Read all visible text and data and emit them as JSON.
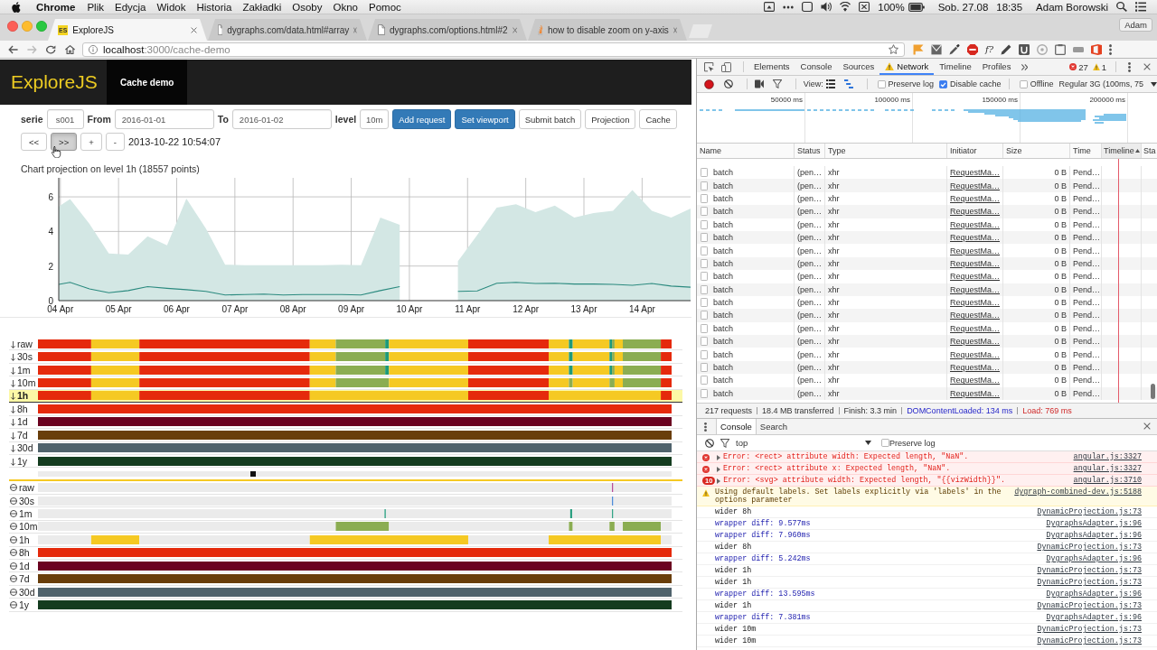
{
  "menu_bar": {
    "app_name": "Chrome",
    "menus": [
      "Plik",
      "Edycja",
      "Widok",
      "Historia",
      "Zakładki",
      "Osoby",
      "Okno",
      "Pomoc"
    ],
    "battery": "100%",
    "date": "Sob. 27.08",
    "time": "18:35",
    "user": "Adam Borowski"
  },
  "browser": {
    "tabs": [
      {
        "kind": "badge",
        "favicon": "ES",
        "title": "ExploreJS",
        "selected": true
      },
      {
        "kind": "page",
        "title": "dygraphs.com/data.html#array",
        "selected": false
      },
      {
        "kind": "page",
        "title": "dygraphs.com/options.html#2",
        "selected": false
      },
      {
        "kind": "site",
        "title": "how to disable zoom on y-axis",
        "selected": false
      }
    ],
    "profile": "Adam",
    "url_host": "localhost",
    "url_path": ":3000/cache-demo",
    "extension_text": "f?"
  },
  "app": {
    "brand": "ExploreJS",
    "nav": [
      {
        "label": "Cache demo",
        "selected": true
      }
    ],
    "fields": [
      {
        "label": "serie",
        "value": "s001",
        "kind": "short"
      },
      {
        "label": "From",
        "value": "2016-01-01",
        "kind": "date"
      },
      {
        "label": "To",
        "value": "2016-01-02",
        "kind": "date"
      },
      {
        "label": "level",
        "value": "10m",
        "kind": "tiny"
      }
    ],
    "buttons": [
      {
        "label": "Add request",
        "kind": "primary"
      },
      {
        "label": "Set viewport",
        "kind": "primary"
      },
      {
        "label": "Submit batch",
        "kind": "default"
      },
      {
        "label": "Projection",
        "kind": "default"
      },
      {
        "label": "Cache",
        "kind": "default"
      }
    ],
    "step_buttons": [
      {
        "label": "<<",
        "pressed": false
      },
      {
        "label": ">>",
        "pressed": true
      },
      {
        "label": "+",
        "pressed": false
      },
      {
        "label": "-",
        "pressed": false
      }
    ],
    "timestamp": "2013-10-22 10:54:07",
    "chart_data": [
      {
        "type": "area",
        "title": "Chart projection on level 1h (18557 points)",
        "series": [
          {
            "type": "area",
            "color": "#d3e7e4",
            "x": [
              "--04-03T23:20",
              "--04-04T04:00",
              "--04-04T12:00",
              "--04-04T20:00",
              "--04-05T04:00",
              "--04-05T12:00",
              "--04-05T20:00",
              "--04-06T04:00",
              "--04-06T12:00",
              "--04-06T20:00",
              "--04-07T04:00",
              "--04-07T12:00",
              "--04-07T20:00",
              "--04-08T04:00",
              "--04-08T12:00",
              "--04-08T20:00",
              "--04-09T04:00",
              "--04-09T12:00",
              "--04-09T20:00"
            ],
            "values": [
              5.44,
              5.87,
              4.43,
              2.73,
              2.66,
              3.72,
              3.2,
              5.9,
              4.18,
              2.08,
              2.05,
              2.05,
              2.05,
              2.05,
              2.05,
              2.07,
              2.05,
              4.8,
              4.38
            ]
          },
          {
            "type": "area",
            "color": "#d3e7e4",
            "x": [
              "--04-10T20:00",
              "--04-11T04:00",
              "--04-11T12:00",
              "--04-11T20:00",
              "--04-12T04:00",
              "--04-12T12:00",
              "--04-12T20:00",
              "--04-13T04:00",
              "--04-13T12:00",
              "--04-13T20:00",
              "--04-14T04:00",
              "--04-14T12:00",
              "--04-14T20:00"
            ],
            "values": [
              2.28,
              3.8,
              5.37,
              5.57,
              5.11,
              5.49,
              4.81,
              5.06,
              5.19,
              6.4,
              5.19,
              4.81,
              5.32
            ]
          },
          {
            "type": "line",
            "color": "#2b8a7f",
            "x": [
              "--04-03T23:20",
              "--04-04T04:00",
              "--04-04T12:00",
              "--04-04T20:00",
              "--04-05T04:00",
              "--04-05T12:00",
              "--04-05T20:00",
              "--04-06T04:00",
              "--04-06T12:00",
              "--04-06T20:00",
              "--04-07T04:00",
              "--04-07T12:00",
              "--04-07T20:00",
              "--04-08T04:00",
              "--04-08T12:00",
              "--04-08T20:00",
              "--04-09T04:00",
              "--04-09T12:00",
              "--04-09T20:00"
            ],
            "values": [
              0.94,
              1.06,
              0.68,
              0.46,
              0.58,
              0.81,
              0.71,
              0.63,
              0.53,
              0.33,
              0.35,
              0.38,
              0.33,
              0.35,
              0.35,
              0.35,
              0.33,
              0.58,
              0.81
            ]
          },
          {
            "type": "line",
            "color": "#2b8a7f",
            "x": [
              "--04-10T20:00",
              "--04-11T04:00",
              "--04-11T12:00",
              "--04-11T20:00",
              "--04-12T04:00",
              "--04-12T12:00",
              "--04-12T20:00",
              "--04-13T04:00",
              "--04-13T12:00",
              "--04-13T20:00",
              "--04-14T04:00",
              "--04-14T12:00",
              "--04-14T20:00"
            ],
            "values": [
              0.53,
              0.56,
              1.01,
              1.06,
              0.99,
              1.01,
              0.96,
              0.96,
              0.94,
              0.89,
              0.99,
              0.84,
              0.78
            ]
          }
        ],
        "xlim": [
          "--04-03T23:20",
          "--04-14T20:00"
        ],
        "ylim": [
          0,
          7.1
        ],
        "yticks": [
          0,
          2,
          4,
          6
        ],
        "xticks": [
          {
            "value": "--04-04",
            "label": "04 Apr"
          },
          {
            "value": "--04-05",
            "label": "05 Apr"
          },
          {
            "value": "--04-06",
            "label": "06 Apr"
          },
          {
            "value": "--04-07",
            "label": "07 Apr"
          },
          {
            "value": "--04-08",
            "label": "08 Apr"
          },
          {
            "value": "--04-09",
            "label": "09 Apr"
          },
          {
            "value": "--04-10",
            "label": "10 Apr"
          },
          {
            "value": "--04-11",
            "label": "11 Apr"
          },
          {
            "value": "--04-12",
            "label": "12 Apr"
          },
          {
            "value": "--04-13",
            "label": "13 Apr"
          },
          {
            "value": "--04-14",
            "label": "14 Apr"
          }
        ],
        "grid": true
      }
    ],
    "cache_levels": [
      {
        "label": "raw",
        "selected": false
      },
      {
        "label": "30s",
        "selected": false
      },
      {
        "label": "1m",
        "selected": false
      },
      {
        "label": "10m",
        "selected": false
      },
      {
        "label": "1h",
        "selected": true
      },
      {
        "label": "8h",
        "selected": false
      },
      {
        "label": "1d",
        "selected": false
      },
      {
        "label": "7d",
        "selected": false
      },
      {
        "label": "30d",
        "selected": false
      },
      {
        "label": "1y",
        "selected": false
      }
    ],
    "scrubber": {
      "level": 0.34
    },
    "projection_levels": [
      {
        "label": "raw",
        "selected": false
      },
      {
        "label": "30s",
        "selected": false
      },
      {
        "label": "1m",
        "selected": false
      },
      {
        "label": "10m",
        "selected": false
      },
      {
        "label": "1h",
        "selected": false
      },
      {
        "label": "8h",
        "selected": false
      },
      {
        "label": "1d",
        "selected": false
      },
      {
        "label": "7d",
        "selected": false
      },
      {
        "label": "30d",
        "selected": false
      },
      {
        "label": "1y",
        "selected": false
      }
    ]
  },
  "devtools": {
    "panels": [
      {
        "label": "Elements",
        "selected": false,
        "warning": false
      },
      {
        "label": "Console",
        "selected": false,
        "warning": false
      },
      {
        "label": "Sources",
        "selected": false,
        "warning": false
      },
      {
        "label": "Network",
        "selected": true,
        "warning": true
      },
      {
        "label": "Timeline",
        "selected": false,
        "warning": false
      },
      {
        "label": "Profiles",
        "selected": false,
        "warning": false
      }
    ],
    "error_count": "27",
    "warning_count": "1",
    "network": {
      "recording": true,
      "view_label": "View:",
      "options": [
        {
          "label": "Preserve log",
          "checked": false
        },
        {
          "label": "Disable cache",
          "checked": true
        },
        {
          "label": "Offline",
          "checked": false
        }
      ],
      "throttling": "Regular 3G (100ms, 75",
      "overview_ticks": [
        "50000 ms",
        "100000 ms",
        "150000 ms",
        "200000 ms"
      ],
      "columns": [
        {
          "label": "Name",
          "sorted": false
        },
        {
          "label": "Status",
          "sorted": false
        },
        {
          "label": "Type",
          "sorted": false
        },
        {
          "label": "Initiator",
          "sorted": false
        },
        {
          "label": "Size",
          "sorted": false
        },
        {
          "label": "Time",
          "sorted": false
        },
        {
          "label": "Timeline",
          "sorted": true
        },
        {
          "label": "Sta",
          "sorted": false
        }
      ],
      "rows": [
        {
          "name": "batch",
          "status": "(pen…",
          "type": "xhr",
          "initiator": "RequestMa…",
          "size": "0 B",
          "time": "Pend…"
        },
        {
          "name": "batch",
          "status": "(pen…",
          "type": "xhr",
          "initiator": "RequestMa…",
          "size": "0 B",
          "time": "Pend…"
        },
        {
          "name": "batch",
          "status": "(pen…",
          "type": "xhr",
          "initiator": "RequestMa…",
          "size": "0 B",
          "time": "Pend…"
        },
        {
          "name": "batch",
          "status": "(pen…",
          "type": "xhr",
          "initiator": "RequestMa…",
          "size": "0 B",
          "time": "Pend…"
        },
        {
          "name": "batch",
          "status": "(pen…",
          "type": "xhr",
          "initiator": "RequestMa…",
          "size": "0 B",
          "time": "Pend…"
        },
        {
          "name": "batch",
          "status": "(pen…",
          "type": "xhr",
          "initiator": "RequestMa…",
          "size": "0 B",
          "time": "Pend…"
        },
        {
          "name": "batch",
          "status": "(pen…",
          "type": "xhr",
          "initiator": "RequestMa…",
          "size": "0 B",
          "time": "Pend…"
        },
        {
          "name": "batch",
          "status": "(pen…",
          "type": "xhr",
          "initiator": "RequestMa…",
          "size": "0 B",
          "time": "Pend…"
        },
        {
          "name": "batch",
          "status": "(pen…",
          "type": "xhr",
          "initiator": "RequestMa…",
          "size": "0 B",
          "time": "Pend…"
        },
        {
          "name": "batch",
          "status": "(pen…",
          "type": "xhr",
          "initiator": "RequestMa…",
          "size": "0 B",
          "time": "Pend…"
        },
        {
          "name": "batch",
          "status": "(pen…",
          "type": "xhr",
          "initiator": "RequestMa…",
          "size": "0 B",
          "time": "Pend…"
        },
        {
          "name": "batch",
          "status": "(pen…",
          "type": "xhr",
          "initiator": "RequestMa…",
          "size": "0 B",
          "time": "Pend…"
        },
        {
          "name": "batch",
          "status": "(pen…",
          "type": "xhr",
          "initiator": "RequestMa…",
          "size": "0 B",
          "time": "Pend…"
        },
        {
          "name": "batch",
          "status": "(pen…",
          "type": "xhr",
          "initiator": "RequestMa…",
          "size": "0 B",
          "time": "Pend…"
        },
        {
          "name": "batch",
          "status": "(pen…",
          "type": "xhr",
          "initiator": "RequestMa…",
          "size": "0 B",
          "time": "Pend…"
        },
        {
          "name": "batch",
          "status": "(pen…",
          "type": "xhr",
          "initiator": "RequestMa…",
          "size": "0 B",
          "time": "Pend…"
        },
        {
          "name": "batch",
          "status": "(pen…",
          "type": "xhr",
          "initiator": "RequestMa…",
          "size": "0 B",
          "time": "Pend…"
        },
        {
          "name": "batch",
          "status": "(pen…",
          "type": "xhr",
          "initiator": "RequestMa…",
          "size": "0 B",
          "time": "Pend…"
        }
      ],
      "summary": [
        {
          "text": "217 requests",
          "kind": "plain"
        },
        {
          "text": "18.4 MB transferred",
          "kind": "plain"
        },
        {
          "text": "Finish: 3.3 min",
          "kind": "plain"
        },
        {
          "text": "DOMContentLoaded: 134 ms",
          "kind": "dom"
        },
        {
          "text": "Load: 769 ms",
          "kind": "load"
        }
      ]
    },
    "console": {
      "tabs": [
        {
          "label": "Console",
          "selected": true
        },
        {
          "label": "Search",
          "selected": false
        }
      ],
      "context": "top",
      "preserve_log": {
        "label": "Preserve log",
        "checked": false
      },
      "messages": [
        {
          "kind": "error",
          "text": "Error: <rect> attribute width: Expected length, \"NaN\".",
          "source": "angular.js:3327"
        },
        {
          "kind": "error",
          "text": "Error: <rect> attribute x: Expected length, \"NaN\".",
          "source": "angular.js:3327"
        },
        {
          "kind": "error",
          "count": "10",
          "text": "Error: <svg> attribute width: Expected length, \"{{vizWidth}}\".",
          "source": "angular.js:3710"
        },
        {
          "kind": "warning",
          "text": "Using default labels. Set labels explicitly via 'labels' in the options parameter",
          "source": "dygraph-combined-dev.js:5188"
        },
        {
          "kind": "log",
          "text": "wider 8h",
          "source": "DynamicProjection.js:73"
        },
        {
          "kind": "debug",
          "text": "wrapper diff: 9.577ms",
          "source": "DygraphsAdapter.js:96"
        },
        {
          "kind": "debug",
          "text": "wrapper diff: 7.960ms",
          "source": "DygraphsAdapter.js:96"
        },
        {
          "kind": "log",
          "text": "wider 8h",
          "source": "DynamicProjection.js:73"
        },
        {
          "kind": "debug",
          "text": "wrapper diff: 5.242ms",
          "source": "DygraphsAdapter.js:96"
        },
        {
          "kind": "log",
          "text": "wider 1h",
          "source": "DynamicProjection.js:73"
        },
        {
          "kind": "log",
          "text": "wider 1h",
          "source": "DynamicProjection.js:73"
        },
        {
          "kind": "debug",
          "text": "wrapper diff: 13.595ms",
          "source": "DygraphsAdapter.js:96"
        },
        {
          "kind": "log",
          "text": "wider 1h",
          "source": "DynamicProjection.js:73"
        },
        {
          "kind": "debug",
          "text": "wrapper diff: 7.381ms",
          "source": "DygraphsAdapter.js:96"
        },
        {
          "kind": "log",
          "text": "wider 10m",
          "source": "DynamicProjection.js:73"
        },
        {
          "kind": "log",
          "text": "wider 10m",
          "source": "DynamicProjection.js:73"
        }
      ]
    }
  }
}
